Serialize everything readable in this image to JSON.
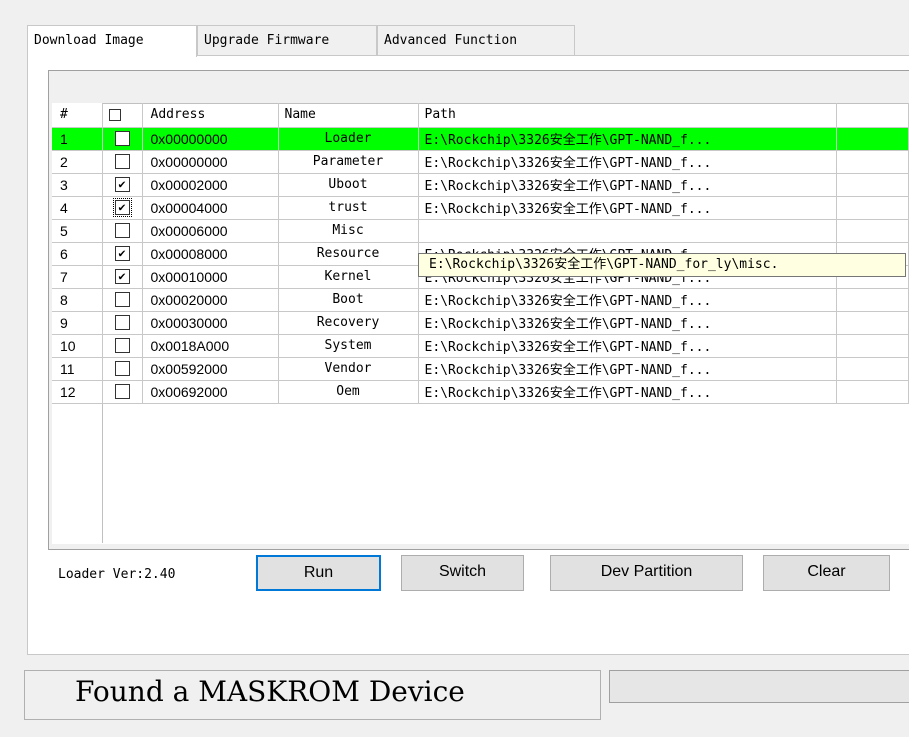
{
  "tabs": [
    {
      "label": "Download Image",
      "active": true
    },
    {
      "label": "Upgrade Firmware",
      "active": false
    },
    {
      "label": "Advanced Function",
      "active": false
    }
  ],
  "table": {
    "headers": {
      "index": "#",
      "address": "Address",
      "name": "Name",
      "path": "Path"
    },
    "rows": [
      {
        "index": "1",
        "checked": false,
        "address": "0x00000000",
        "name": "Loader",
        "path": "E:\\Rockchip\\3326安全工作\\GPT-NAND_f..."
      },
      {
        "index": "2",
        "checked": false,
        "address": "0x00000000",
        "name": "Parameter",
        "path": "E:\\Rockchip\\3326安全工作\\GPT-NAND_f..."
      },
      {
        "index": "3",
        "checked": true,
        "address": "0x00002000",
        "name": "Uboot",
        "path": "E:\\Rockchip\\3326安全工作\\GPT-NAND_f..."
      },
      {
        "index": "4",
        "checked": true,
        "address": "0x00004000",
        "name": "trust",
        "path": "E:\\Rockchip\\3326安全工作\\GPT-NAND_f..."
      },
      {
        "index": "5",
        "checked": false,
        "address": "0x00006000",
        "name": "Misc",
        "path": ""
      },
      {
        "index": "6",
        "checked": true,
        "address": "0x00008000",
        "name": "Resource",
        "path": "E:\\Rockchip\\3326安全工作\\GPT-NAND_f..."
      },
      {
        "index": "7",
        "checked": true,
        "address": "0x00010000",
        "name": "Kernel",
        "path": "E:\\Rockchip\\3326安全工作\\GPT-NAND_f..."
      },
      {
        "index": "8",
        "checked": false,
        "address": "0x00020000",
        "name": "Boot",
        "path": "E:\\Rockchip\\3326安全工作\\GPT-NAND_f..."
      },
      {
        "index": "9",
        "checked": false,
        "address": "0x00030000",
        "name": "Recovery",
        "path": "E:\\Rockchip\\3326安全工作\\GPT-NAND_f..."
      },
      {
        "index": "10",
        "checked": false,
        "address": "0x0018A000",
        "name": "System",
        "path": "E:\\Rockchip\\3326安全工作\\GPT-NAND_f..."
      },
      {
        "index": "11",
        "checked": false,
        "address": "0x00592000",
        "name": "Vendor",
        "path": "E:\\Rockchip\\3326安全工作\\GPT-NAND_f..."
      },
      {
        "index": "12",
        "checked": false,
        "address": "0x00692000",
        "name": "Oem",
        "path": "E:\\Rockchip\\3326安全工作\\GPT-NAND_f..."
      }
    ],
    "selected_row": "1",
    "tooltip": "E:\\Rockchip\\3326安全工作\\GPT-NAND_for_ly\\misc."
  },
  "loader_version": "Loader Ver:2.40",
  "buttons": {
    "run": "Run",
    "switch": "Switch",
    "dev_partition": "Dev Partition",
    "clear": "Clear"
  },
  "status": {
    "message": "Found a MASKROM Device",
    "progress": 0
  },
  "colors": {
    "selected_row": "#00ff00",
    "tooltip_bg": "#ffffe1",
    "default_button_border": "#0078d7"
  }
}
